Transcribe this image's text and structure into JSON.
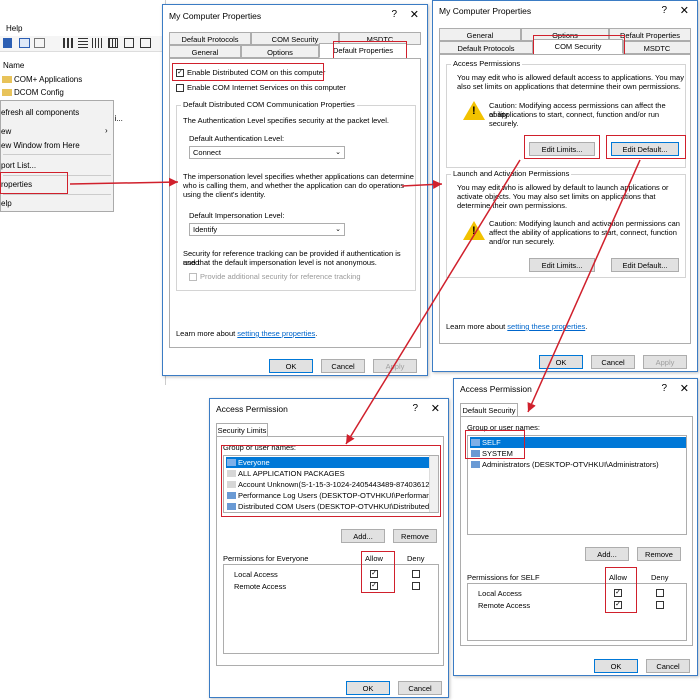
{
  "mmc": {
    "menu_help": "Help",
    "column_name": "Name",
    "tree_items": [
      "COM+ Applications",
      "DCOM Config",
      "di..."
    ],
    "context_menu": [
      "efresh all components",
      "ew",
      "ew Window from Here",
      "port List...",
      "roperties",
      "elp"
    ],
    "submenu_arrow": "›"
  },
  "win1": {
    "title": "My Computer Properties",
    "help": "?",
    "close": "✕",
    "tabs_row1": [
      "Default Protocols",
      "COM Security",
      "MSDTC"
    ],
    "tabs_row2": [
      "General",
      "Options",
      "Default Properties"
    ],
    "enable_dcom": "Enable Distributed COM on this computer",
    "enable_cis": "Enable COM Internet Services on this computer",
    "group_title": "Default Distributed COM Communication Properties",
    "auth_desc": "The Authentication Level specifies security at the packet level.",
    "auth_label": "Default Authentication Level:",
    "auth_value": "Connect",
    "imp_desc1": "The impersonation level specifies whether applications can determine",
    "imp_desc2": "who is calling them, and whether the application can do operations",
    "imp_desc3": "using the client's identity.",
    "imp_label": "Default Impersonation Level:",
    "imp_value": "Identify",
    "ref_desc1": "Security for reference tracking can be provided if authentication is used",
    "ref_desc2": "and that the default impersonation level is not anonymous.",
    "ref_check": "Provide additional security for reference tracking",
    "learn_prefix": "Learn more about ",
    "learn_link": "setting these properties",
    "learn_suffix": ".",
    "ok": "OK",
    "cancel": "Cancel",
    "apply": "Apply"
  },
  "win2": {
    "title": "My Computer Properties",
    "help": "?",
    "close": "✕",
    "tabs_row1": [
      "General",
      "Options",
      "Default Properties"
    ],
    "tabs_row2": [
      "Default Protocols",
      "COM Security",
      "MSDTC"
    ],
    "ap_group": "Access Permissions",
    "ap_desc1": "You may edit who is allowed default access to applications. You may",
    "ap_desc2": "also set limits on applications that determine their own permissions.",
    "ap_caution1": "Caution: Modifying access permissions can affect the ability",
    "ap_caution2": "of applications to start, connect, function and/or run",
    "ap_caution3": "securely.",
    "edit_limits": "Edit Limits...",
    "edit_default": "Edit Default...",
    "la_group": "Launch and Activation Permissions",
    "la_desc1": "You may edit who is allowed by default to launch applications or",
    "la_desc2": "activate objects. You may also set limits on applications that",
    "la_desc3": "determine their own permissions.",
    "la_caution1": "Caution: Modifying launch and activation permissions can",
    "la_caution2": "affect the ability of applications to start, connect, function",
    "la_caution3": "and/or run securely.",
    "edit_limits2": "Edit Limits...",
    "edit_default2": "Edit Default...",
    "learn_prefix": "Learn more about ",
    "learn_link": "setting these properties",
    "learn_suffix": ".",
    "ok": "OK",
    "cancel": "Cancel",
    "apply": "Apply"
  },
  "win3": {
    "title": "Access Permission",
    "help": "?",
    "close": "✕",
    "tab": "Security Limits",
    "group_label": "Group or user names:",
    "users": [
      "Everyone",
      "ALL APPLICATION PACKAGES",
      "Account Unknown(S-1-15-3-1024-2405443489-874036122",
      "Performance Log Users (DESKTOP-OTVHKUI\\Performanc",
      "Distributed COM Users (DESKTOP-OTVHKUI\\Distributed C"
    ],
    "add": "Add...",
    "remove": "Remove",
    "perm_label": "Permissions for Everyone",
    "allow": "Allow",
    "deny": "Deny",
    "perms": [
      "Local Access",
      "Remote Access"
    ],
    "ok": "OK",
    "cancel": "Cancel"
  },
  "win4": {
    "title": "Access Permission",
    "help": "?",
    "close": "✕",
    "tab": "Default Security",
    "group_label": "Group or user names:",
    "users": [
      "SELF",
      "SYSTEM",
      "Administrators (DESKTOP-OTVHKUI\\Administrators)"
    ],
    "add": "Add...",
    "remove": "Remove",
    "perm_label": "Permissions for SELF",
    "allow": "Allow",
    "deny": "Deny",
    "perms": [
      "Local Access",
      "Remote Access"
    ],
    "ok": "OK",
    "cancel": "Cancel"
  },
  "check_mark": "✓",
  "colors": {
    "highlight": "#d0202c",
    "selection": "#0078d7",
    "link": "#0066cc"
  }
}
